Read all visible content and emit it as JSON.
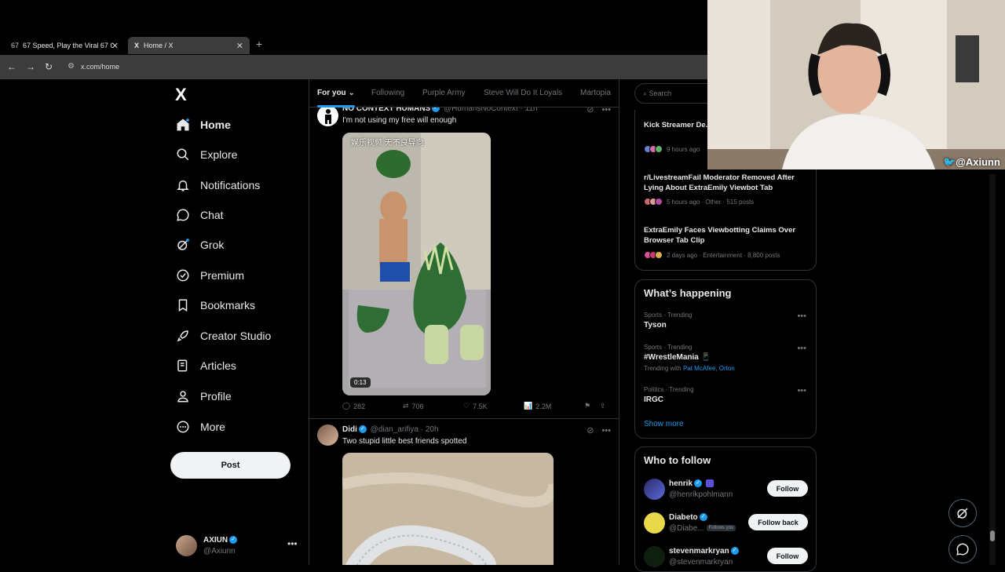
{
  "browser": {
    "tabs": [
      {
        "favicon": "67",
        "label": "67 Speed, Play the Viral 67 Gam"
      },
      {
        "favicon": "X",
        "label": "Home / X"
      }
    ],
    "new_tab": "+",
    "url": "x.com/home"
  },
  "sidebar": {
    "logo": "X",
    "items": [
      {
        "label": "Home",
        "icon": "home-icon"
      },
      {
        "label": "Explore",
        "icon": "search-icon"
      },
      {
        "label": "Notifications",
        "icon": "bell-icon"
      },
      {
        "label": "Chat",
        "icon": "chat-icon"
      },
      {
        "label": "Grok",
        "icon": "grok-icon"
      },
      {
        "label": "Premium",
        "icon": "premium-icon"
      },
      {
        "label": "Bookmarks",
        "icon": "bookmark-icon"
      },
      {
        "label": "Creator Studio",
        "icon": "rocket-icon"
      },
      {
        "label": "Articles",
        "icon": "article-icon"
      },
      {
        "label": "Profile",
        "icon": "person-icon"
      },
      {
        "label": "More",
        "icon": "more-circle-icon"
      }
    ],
    "post_label": "Post",
    "account": {
      "name": "AXIUN",
      "handle": "@Axiunn",
      "more": "•••"
    }
  },
  "feed": {
    "tabs": [
      "For you",
      "Following",
      "Purple Army",
      "Steve Will Do It Loyals",
      "Martopia"
    ],
    "tweets": [
      {
        "name": "NO CONTEXT HUMANS",
        "handle": "@HumansNoContext",
        "time": "11h",
        "text": "I'm not using my free will enough",
        "media_caption": "娱乐视频 无不良导向",
        "duration": "0:13",
        "replies": "282",
        "reposts": "706",
        "likes": "7.5K",
        "views": "2.2M"
      },
      {
        "name": "Didi",
        "handle": "@dian_arifiya",
        "time": "20h",
        "text": "Two stupid little best friends spotted"
      }
    ]
  },
  "right": {
    "search_placeholder": "Search",
    "news": [
      {
        "title": "Kick Streamer De... Man at LA Club P...",
        "meta": "9 hours ago"
      },
      {
        "title": "r/LivestreamFail Moderator Removed After Lying About ExtraEmily Viewbot Tab",
        "meta": "5 hours ago · Other · 515 posts"
      },
      {
        "title": "ExtraEmily Faces Viewbotting Claims Over Browser Tab Clip",
        "meta": "2 days ago · Entertainment · 8,800 posts"
      }
    ],
    "happening": {
      "title": "What’s happening",
      "trends": [
        {
          "category": "Sports · Trending",
          "name": "Tyson"
        },
        {
          "category": "Sports · Trending",
          "name": "#WrestleMania 📱",
          "with_prefix": "Trending with ",
          "with_links": "Pat McAfee, Orton"
        },
        {
          "category": "Politics · Trending",
          "name": "IRGC"
        }
      ],
      "show_more": "Show more"
    },
    "who_to_follow": {
      "title": "Who to follow",
      "users": [
        {
          "name": "henrik",
          "handle": "@henrikpohlmann",
          "button": "Follow"
        },
        {
          "name": "Diabeto",
          "handle": "@Diabe...",
          "badge": "Follows you",
          "button": "Follow back"
        },
        {
          "name": "stevenmarkryan",
          "handle": "@stevenmarkryan",
          "button": "Follow"
        }
      ]
    }
  },
  "webcam": {
    "tag": "@Axiunn"
  },
  "colors": {
    "accent": "#1d9bf0",
    "background": "#000000",
    "border": "#2f3336",
    "muted": "#71767b"
  }
}
